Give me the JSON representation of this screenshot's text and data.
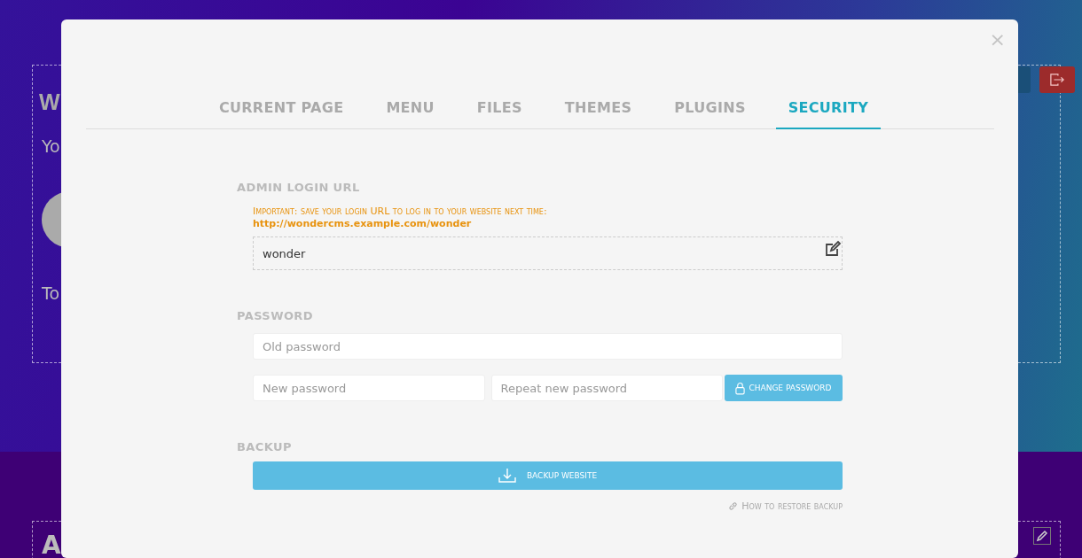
{
  "background_page": {
    "heading": "W",
    "subtitle": "Yo",
    "text": "To",
    "footer_heading": "A"
  },
  "modal": {
    "close": "×",
    "tabs": [
      {
        "label": "CURRENT PAGE",
        "selected": false
      },
      {
        "label": "MENU",
        "selected": false
      },
      {
        "label": "FILES",
        "selected": false
      },
      {
        "label": "THEMES",
        "selected": false
      },
      {
        "label": "PLUGINS",
        "selected": false
      },
      {
        "label": "SECURITY",
        "selected": true
      }
    ],
    "admin_login_url": {
      "title": "ADMIN LOGIN URL",
      "note": "Important: save your login URL to log in to your website next time:",
      "url": "http://wondercms.example.com/wonder",
      "value": "wonder"
    },
    "password": {
      "title": "PASSWORD",
      "old_placeholder": "Old password",
      "new_placeholder": "New password",
      "repeat_placeholder": "Repeat new password",
      "button": "CHANGE PASSWORD"
    },
    "backup": {
      "title": "BACKUP",
      "button": "BACKUP WEBSITE",
      "link": "How to restore backup"
    }
  }
}
